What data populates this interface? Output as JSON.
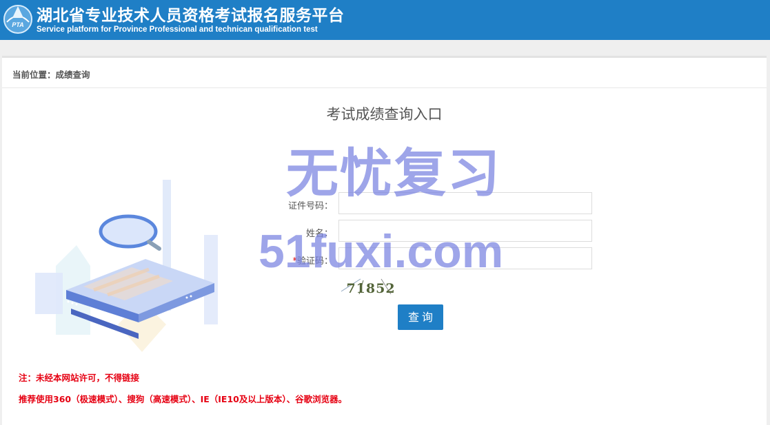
{
  "header": {
    "logo_text": "PTA",
    "title": "湖北省专业技术人员资格考试报名服务平台",
    "subtitle": "Service platform for Province Professional and technican qualification test"
  },
  "breadcrumb": {
    "text": "当前位置：成绩查询"
  },
  "form": {
    "title": "考试成绩查询入口",
    "id_label": "证件号码：",
    "id_value": "",
    "name_label": "姓名：",
    "name_value": "",
    "captcha_required_mark": "*",
    "captcha_label": "验证码：",
    "captcha_value": "",
    "captcha_text": "71852",
    "submit_label": "查询"
  },
  "notes": {
    "line1": "注：未经本网站许可，不得链接",
    "line2": "推荐使用360（极速模式）、搜狗（高速模式）、IE（IE10及以上版本）、谷歌浏览器。"
  },
  "watermark": {
    "line1": "无忧复习",
    "line2": "51fuxi.com"
  },
  "colors": {
    "header_bg": "#1f7fc6",
    "button_bg": "#1f7fc6",
    "note_red": "#e60012"
  }
}
